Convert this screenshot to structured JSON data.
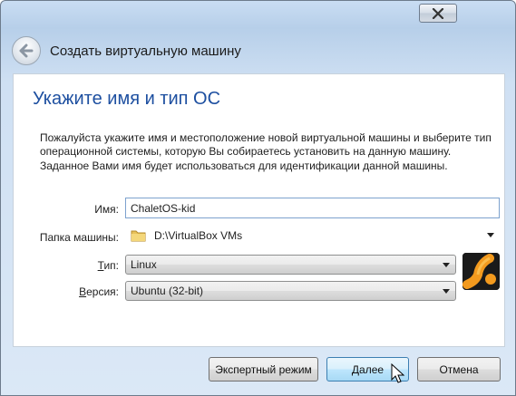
{
  "window": {
    "close_icon": "close-icon"
  },
  "header": {
    "back_icon": "back-arrow-icon",
    "title": "Создать виртуальную машину"
  },
  "page": {
    "title": "Укажите имя и тип ОС",
    "description": "Пожалуйста укажите имя и местоположение новой виртуальной машины и выберите тип операционной системы, которую Вы собираетесь установить на данную машину. Заданное Вами имя будет использоваться для идентификации данной машины."
  },
  "form": {
    "name_label": "Имя:",
    "name_value": "ChaletOS-kid",
    "folder_label": "Папка машины:",
    "folder_value": "D:\\VirtualBox VMs",
    "type_label_pre": "",
    "type_label_ul": "Т",
    "type_label_post": "ип:",
    "type_value": "Linux",
    "version_label_pre": "",
    "version_label_ul": "В",
    "version_label_post": "ерсия:",
    "version_value": "Ubuntu (32-bit)",
    "os_icon": "ubuntu-os-icon"
  },
  "buttons": {
    "expert": "Экспертный режим",
    "next": "Далее",
    "cancel": "Отмена"
  },
  "colors": {
    "title_blue": "#1d4fa0",
    "window_frame": "#c9ddf3",
    "default_button": "#bee6fd"
  }
}
